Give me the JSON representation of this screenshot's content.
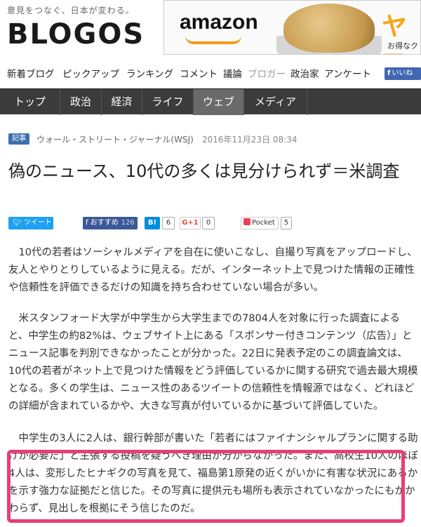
{
  "header": {
    "tagline": "意見をつなぐ、日本が変わる。",
    "logo": "BLOGOS",
    "ad": {
      "brand": "amazon",
      "headline_fragment": "ヤフ",
      "sub_fragment": "お得なク"
    }
  },
  "subnav": {
    "items": [
      "新着ブログ",
      "ピックアップ",
      "ランキング",
      "コメント",
      "議論",
      "ブロガー",
      "政治家",
      "アンケート"
    ],
    "active": "ブロガー",
    "like_label": "いいね"
  },
  "mainnav": {
    "items": [
      "トップ",
      "政治",
      "経済",
      "ライフ",
      "ウェブ",
      "メディア"
    ],
    "active": "ウェブ"
  },
  "article": {
    "category": "記事",
    "source": "ウォール・ストリート・ジャーナル(WSJ)",
    "date": "2016年11月23日 08:34",
    "title": "偽のニュース、10代の多くは見分けられず＝米調査",
    "share": {
      "tweet": "ツイート",
      "fb_label": "おすすめ",
      "fb_count": "126",
      "hatena_label": "B!",
      "hatena_count": "6",
      "gplus_label": "G+1",
      "gplus_count": "0",
      "pocket_label": "Pocket",
      "pocket_count": "5"
    },
    "paragraphs": [
      "10代の若者はソーシャルメディアを自在に使いこなし、自撮り写真をアップロードし、友人とやりとりしているように見える。だが、インターネット上で見つけた情報の正確性や信頼性を評価できるだけの知識を持ち合わせていない場合が多い。",
      "米スタンフォード大学が中学生から大学生までの7804人を対象に行った調査によると、中学生の約82%は、ウェブサイト上にある「スポンサー付きコンテンツ（広告）」とニュース記事を判別できなかったことが分かった。22日に発表予定のこの調査論文は、10代の若者がネット上で見つけた情報をどう評価しているかに関する研究で過去最大規模となる。多くの学生は、ニュース性のあるツイートの信頼性を情報源ではなく、どれほどの詳細が含まれているかや、大きな写真が付いているかに基づいて評価していた。",
      "中学生の3人に2人は、銀行幹部が書いた「若者にはファイナンシャルプランに関する助けが必要だ」と主張する投稿を疑うべき理由が分からなかった。また、高校生10人のほぼ4人は、変形したヒナギクの写真を見て、福島第1原発の近くがいかに有害な状況にあるかを示す強力な証拠だと信じた。その写真に提供元も場所も表示されていなかったにもかかわらず、見出しを根拠にそう信じたのだ。"
    ]
  },
  "colors": {
    "nav_bg": "#3b3b3b",
    "nav_active": "#6a6a6a",
    "highlight": "#ec3c7a",
    "category": "#3a6fb0"
  }
}
